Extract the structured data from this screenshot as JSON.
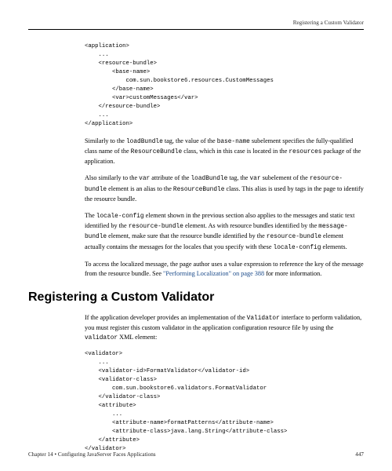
{
  "running_head": "Registering a Custom Validator",
  "code1": "<application>\n    ...\n    <resource-bundle>\n        <base-name>\n            com.sun.bookstore6.resources.CustomMessages\n        </base-name>\n        <var>customMessages</var>\n    </resource-bundle>\n    ...\n</application>",
  "para1_a": "Similarly to the ",
  "para1_b": " tag, the value of the ",
  "para1_c": " subelement specifies the fully-qualified class name of the ",
  "para1_d": " class, which in this case is located in the ",
  "para1_e": " package of the application.",
  "m1a": "loadBundle",
  "m1b": "base-name",
  "m1c": "ResourceBundle",
  "m1d": "resources",
  "para2_a": "Also similarly to the ",
  "para2_b": " attribute of the ",
  "para2_c": " tag, the ",
  "para2_d": " subelement of the ",
  "para2_e": " element is an alias to the ",
  "para2_f": " class. This alias is used by tags in the page to identify the resource bundle.",
  "m2a": "var",
  "m2b": "loadBundle",
  "m2c": "var",
  "m2d": "resource-bundle",
  "m2e": "ResourceBundle",
  "para3_a": "The ",
  "para3_b": " element shown in the previous section also applies to the messages and static text identified by the ",
  "para3_c": " element. As with resource bundles identified by the ",
  "para3_d": " element, make sure that the resource bundle identified by the ",
  "para3_e": " element actually contains the messages for the locales that you specify with these ",
  "para3_f": " elements.",
  "m3a": "locale-config",
  "m3b": "resource-bundle",
  "m3c": "message-bundle",
  "m3d": "resource-bundle",
  "m3e": "locale-config",
  "para4_a": "To access the localized message, the page author uses a value expression to reference the key of the message from the resource bundle. See ",
  "para4_link": "\"Performing Localization\" on page 388",
  "para4_b": " for more information.",
  "heading": "Registering a Custom Validator",
  "para5_a": "If the application developer provides an implementation of the ",
  "para5_b": " interface to perform validation, you must register this custom validator in the application configuration resource file by using the ",
  "para5_c": " XML element:",
  "m5a": "Validator",
  "m5b": "validator",
  "code2": "<validator>\n    ...\n    <validator-id>FormatValidator</validator-id>\n    <validator-class>\n        com.sun.bookstore6.validators.FormatValidator\n    </validator-class>\n    <attribute>\n        ...\n        <attribute-name>formatPatterns</attribute-name>\n        <attribute-class>java.lang.String</attribute-class>\n    </attribute>\n</validator>",
  "footer_left": "Chapter 14 • Configuring JavaServer Faces Applications",
  "footer_right": "447"
}
